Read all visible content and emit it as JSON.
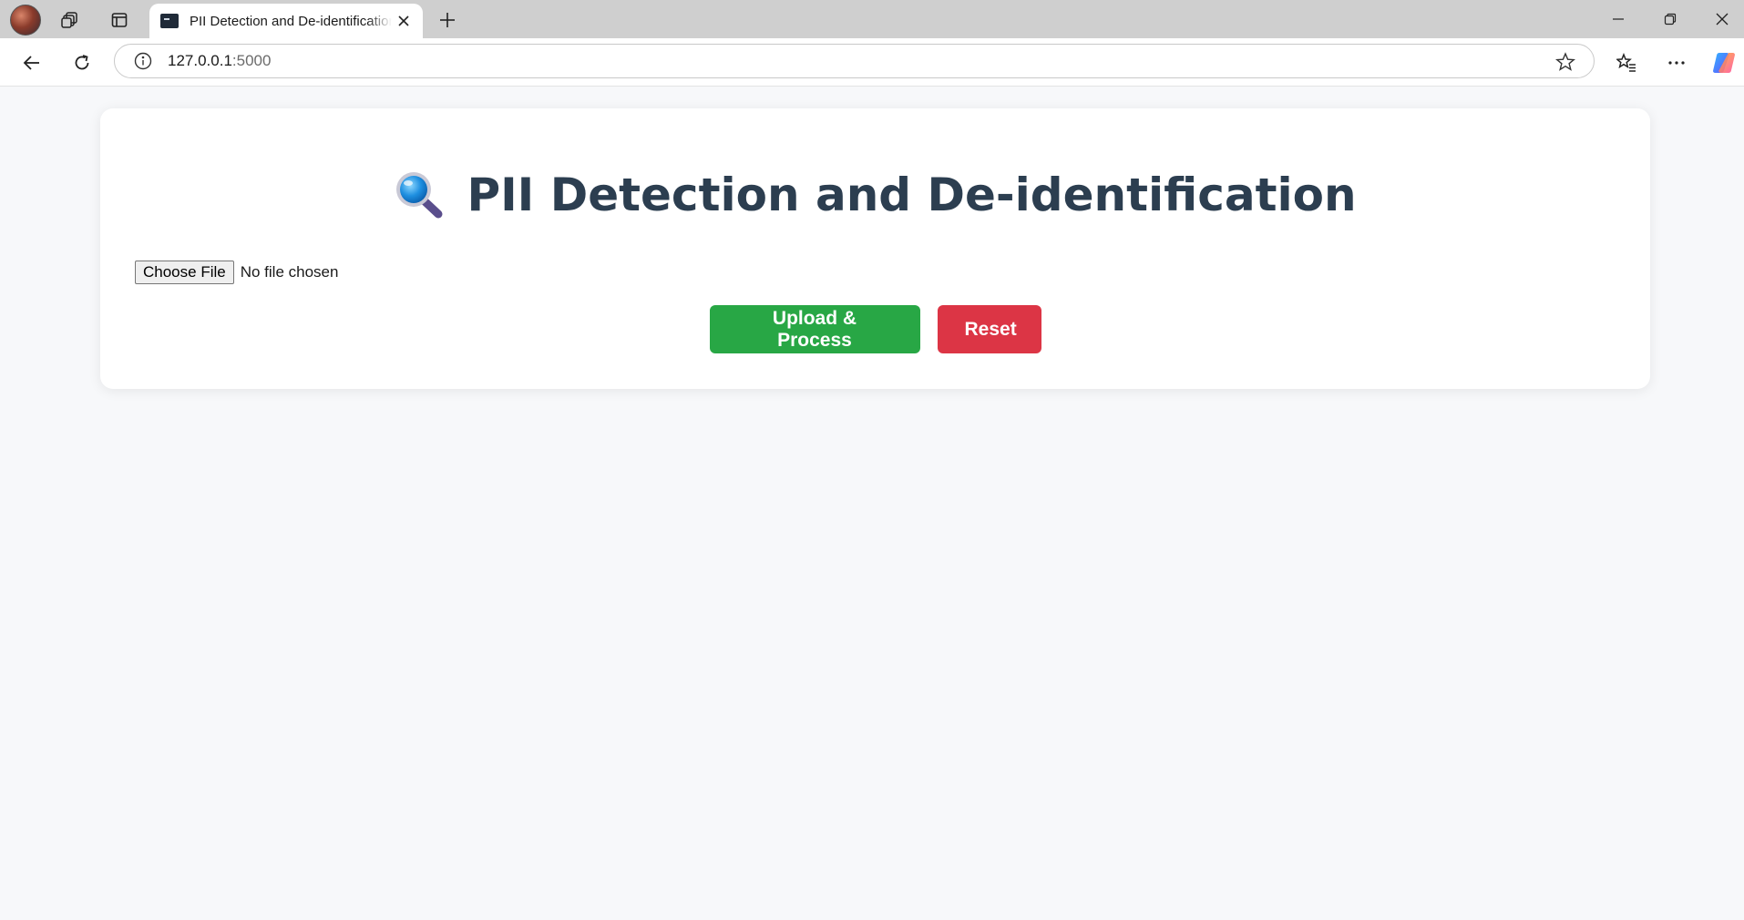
{
  "browser": {
    "tab": {
      "title": "PII Detection and De-identification"
    },
    "address": {
      "host": "127.0.0.1",
      "port": ":5000"
    }
  },
  "page": {
    "title": "PII Detection and De-identification",
    "file_input": {
      "button_label": "Choose File",
      "status": "No file chosen"
    },
    "buttons": {
      "upload": "Upload & Process",
      "reset": "Reset"
    }
  },
  "colors": {
    "heading": "#2c3e50",
    "upload_button": "#28a745",
    "reset_button": "#dc3545"
  },
  "icons": {
    "title": "magnifying-glass-icon"
  }
}
